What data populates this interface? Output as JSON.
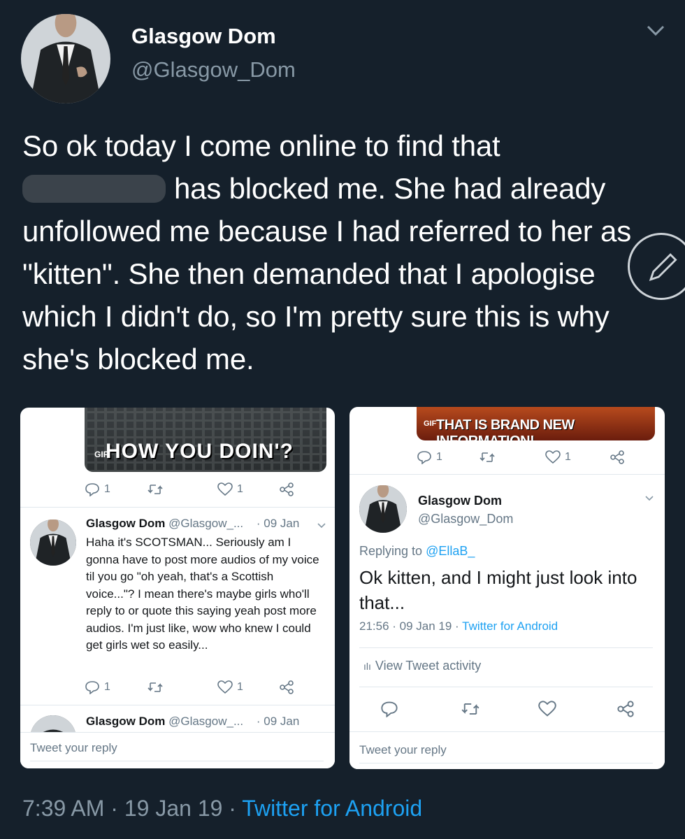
{
  "header": {
    "name": "Glasgow Dom",
    "handle": "@Glasgow_Dom"
  },
  "tweet": {
    "line1": "So ok today I come online to find that",
    "line2_after": "has blocked me. She had already",
    "rest": "unfollowed me because I had referred to her as \"kitten\". She then demanded that I apologise which I didn't do, so I'm pretty sure this is why she's blocked me."
  },
  "meta": {
    "time": "7:39 AM",
    "sep1": " · ",
    "date": "19 Jan 19",
    "sep2": " · ",
    "source": "Twitter for Android"
  },
  "shot1": {
    "gif_caption": "HOW YOU DOIN'?",
    "gif_label": "GIF",
    "actions": {
      "reply": "1",
      "like": "1"
    },
    "reply": {
      "name": "Glasgow Dom",
      "handle": "@Glasgow_...",
      "date": "· 09 Jan",
      "text": "Haha it's SCOTSMAN... Seriously am I gonna have to post more audios of my voice til you go \"oh yeah, that's a Scottish voice...\"? I mean there's maybe girls who'll reply to or quote this saying yeah post more audios. I'm just like, wow who knew I could get girls wet so easily..."
    },
    "actions2": {
      "reply": "1",
      "like": "1"
    },
    "next": {
      "name": "Glasgow Dom",
      "handle": "@Glasgow_...",
      "date": "· 09 Jan"
    },
    "reply_placeholder": "Tweet your reply"
  },
  "shot2": {
    "gif_caption": "THAT IS BRAND NEW INFORMATION!",
    "gif_label": "GIF",
    "actions": {
      "reply": "1",
      "like": "1"
    },
    "name": "Glasgow Dom",
    "handle": "@Glasgow_Dom",
    "replying_label": "Replying to",
    "replying_to": "@EllaB_",
    "text": "Ok kitten, and I might just look into that...",
    "time": "21:56 · 09 Jan 19 · ",
    "source": "Twitter for Android",
    "activity": "View Tweet activity",
    "reply_placeholder": "Tweet your reply"
  }
}
